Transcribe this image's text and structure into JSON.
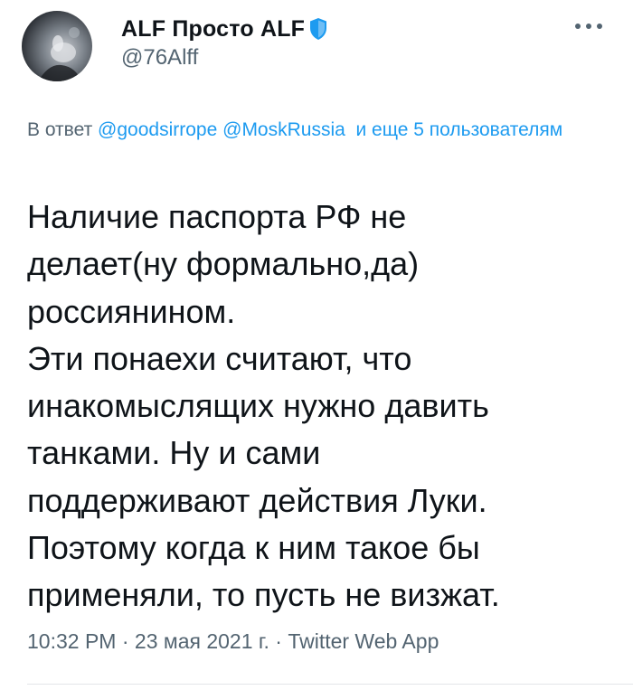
{
  "author": {
    "display_name": "ALF Просто ALF",
    "handle": "@76Alff",
    "badge_icon": "shield-icon",
    "badge_color": "#1d9bf0"
  },
  "reply": {
    "prefix": "В ответ",
    "mention_1": "@goodsirrope",
    "mention_2": "@MoskRussia",
    "others": "и еще 5 пользователям"
  },
  "tweet": {
    "text": "Наличие паспорта РФ не\nделает(ну формально,да)\nроссиянином.\nЭти понаехи считают, что\nинакомыслящих нужно давить\nтанками. Ну и сами\nподдерживают действия Луки.\nПоэтому когда к ним такое бы\nприменяли, то пусть не визжат."
  },
  "meta": {
    "time": "10:32 PM",
    "date": "23 мая 2021 г.",
    "separator": "·",
    "app": "Twitter Web App"
  },
  "colors": {
    "link": "#1d9bf0",
    "secondary": "#536471",
    "text": "#0f1419"
  }
}
